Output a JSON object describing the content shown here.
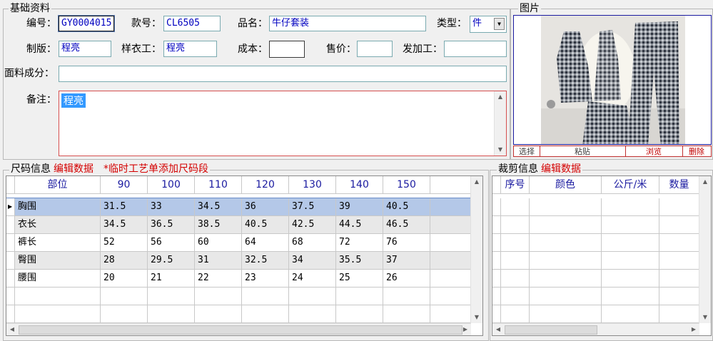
{
  "basic": {
    "legend": "基础资料",
    "code_label": "编号：",
    "code_value": "GY0004015",
    "style_label": "款号：",
    "style_value": "CL6505",
    "name_label": "品名：",
    "name_value": "牛仔套装",
    "type_label": "类型：",
    "type_value": "件",
    "plate_label": "制版：",
    "plate_value": "程亮",
    "sample_label": "样衣工：",
    "sample_value": "程亮",
    "cost_label": "成本：",
    "cost_value": "",
    "price_label": "售价：",
    "price_value": "",
    "process_label": "发加工：",
    "process_value": "",
    "fabric_label": "面料成分：",
    "fabric_value": "",
    "note_label": "备注：",
    "note_value": "程亮"
  },
  "photo": {
    "legend": "图片",
    "buttons": [
      "选择",
      "粘贴",
      "浏览",
      "删除"
    ]
  },
  "size": {
    "legend": "尺码信息",
    "edit_link": "编辑数据",
    "temp_link": "*临时工艺单添加尺码段",
    "columns": [
      "部位",
      "90",
      "100",
      "110",
      "120",
      "130",
      "140",
      "150"
    ],
    "rows": [
      [
        "胸围",
        "31.5",
        "33",
        "34.5",
        "36",
        "37.5",
        "39",
        "40.5"
      ],
      [
        "衣长",
        "34.5",
        "36.5",
        "38.5",
        "40.5",
        "42.5",
        "44.5",
        "46.5"
      ],
      [
        "裤长",
        "52",
        "56",
        "60",
        "64",
        "68",
        "72",
        "76"
      ],
      [
        "臀围",
        "28",
        "29.5",
        "31",
        "32.5",
        "34",
        "35.5",
        "37"
      ],
      [
        "腰围",
        "20",
        "21",
        "22",
        "23",
        "24",
        "25",
        "26"
      ]
    ]
  },
  "cut": {
    "legend": "裁剪信息",
    "edit_link": "编辑数据",
    "columns": [
      "序号",
      "颜色",
      "公斤/米",
      "数量"
    ]
  },
  "colors": {
    "selected_row": "#b4c8e8",
    "alt_row": "#e8e8e8",
    "header_text": "#1a1aa0",
    "link_red": "#d40000"
  }
}
